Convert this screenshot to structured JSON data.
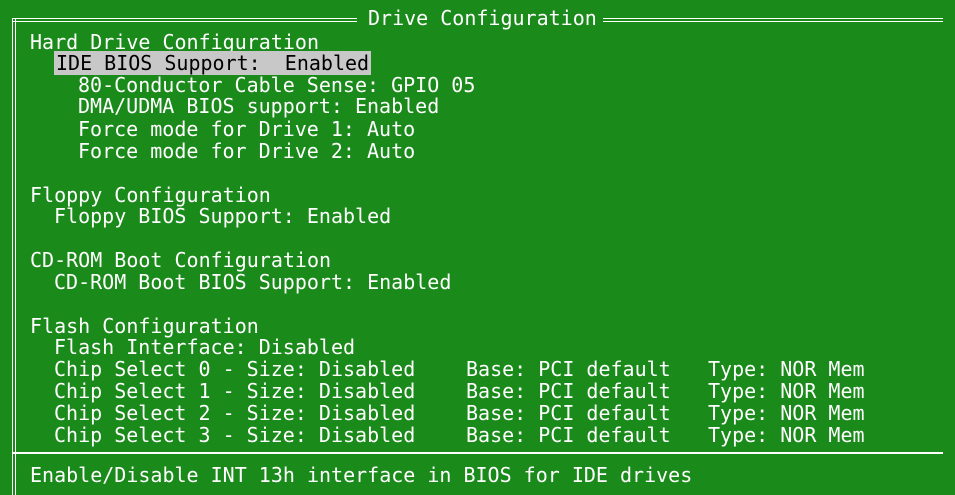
{
  "window": {
    "title": "Drive Configuration"
  },
  "hard_drive": {
    "header": "Hard Drive Configuration",
    "ide_bios": "IDE BIOS Support:  Enabled",
    "cable_sense": "80-Conductor Cable Sense: GPIO 05",
    "dma_udma": "DMA/UDMA BIOS support: Enabled",
    "force_drive1": "Force mode for Drive 1: Auto",
    "force_drive2": "Force mode for Drive 2: Auto"
  },
  "floppy": {
    "header": "Floppy Configuration",
    "bios_support": "Floppy BIOS Support: Enabled"
  },
  "cdrom": {
    "header": "CD-ROM Boot Configuration",
    "bios_support": "CD-ROM Boot BIOS Support: Enabled"
  },
  "flash": {
    "header": "Flash Configuration",
    "interface": "Flash Interface: Disabled",
    "chip_selects": [
      {
        "size": "Chip Select 0 - Size: Disabled",
        "base": "Base: PCI default",
        "type": "Type: NOR Mem"
      },
      {
        "size": "Chip Select 1 - Size: Disabled",
        "base": "Base: PCI default",
        "type": "Type: NOR Mem"
      },
      {
        "size": "Chip Select 2 - Size: Disabled",
        "base": "Base: PCI default",
        "type": "Type: NOR Mem"
      },
      {
        "size": "Chip Select 3 - Size: Disabled",
        "base": "Base: PCI default",
        "type": "Type: NOR Mem"
      }
    ]
  },
  "help_text": "Enable/Disable INT 13h interface in BIOS for IDE drives",
  "colors": {
    "background": "#1a8a1a",
    "text": "#ffffff",
    "highlight_bg": "#c8c8c8",
    "highlight_text": "#000000"
  }
}
